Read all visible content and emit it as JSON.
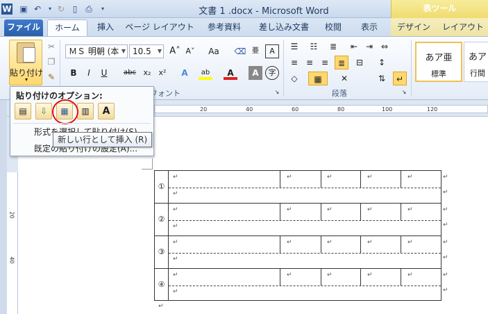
{
  "window": {
    "title": "文書 1 .docx - Microsoft Word",
    "table_tools_label": "表ツール"
  },
  "tabs": {
    "file": "ファイル",
    "home": "ホーム",
    "insert": "挿入",
    "page_layout": "ページ レイアウト",
    "references": "参考資料",
    "mailings": "差し込み文書",
    "review": "校閲",
    "view": "表示",
    "design": "デザイン",
    "layout": "レイアウト"
  },
  "ribbon": {
    "paste_label": "貼り付け",
    "font_name": "ＭＳ 明朝 (本",
    "font_size": "10.5",
    "font_group_label": "フォント",
    "paragraph_group_label": "段落",
    "style_normal_sample": "あア亜",
    "style_normal_name": "標準",
    "style_nospacing_sample": "あア",
    "style_nospacing_name": "行間",
    "aa_label": "Aa",
    "buttons": {
      "bold": "B",
      "italic": "I",
      "underline": "U",
      "strike": "abc",
      "subscript": "x₂",
      "superscript": "x²"
    }
  },
  "paste_popup": {
    "title": "貼り付けのオプション:",
    "menu_select_format": "形式を選択して貼り付け(S)...",
    "menu_default_settings": "既定の貼り付けの設定(A)...",
    "tooltip": "新しい行として挿入 (R)"
  },
  "ruler": {
    "h_numbers": [
      "20",
      "40",
      "60",
      "80",
      "100",
      "120"
    ],
    "v_numbers": [
      "20",
      "40"
    ]
  },
  "document": {
    "paragraph_mark": "↵",
    "row_numbers": [
      "①",
      "②",
      "③",
      "④"
    ]
  }
}
